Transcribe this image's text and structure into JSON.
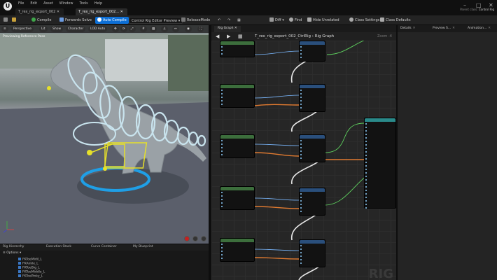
{
  "menu": [
    "File",
    "Edit",
    "Asset",
    "Window",
    "Tools",
    "Help"
  ],
  "doc_tabs": [
    "T_rex_rig_export_002",
    "T_rex_rig_export_002..."
  ],
  "parent_class": {
    "label": "Parent class:",
    "value": "Control Rig"
  },
  "toolbar": {
    "compile": "Compile",
    "forwards_solve": "Forwards Solve",
    "auto_compile": "Auto Compile",
    "preview_mode": "Control Rig Editor Preview",
    "release_mode": "ReleaseMode",
    "diff": "Diff",
    "find": "Find",
    "hide_unrelated": "Hide Unrelated",
    "class_settings": "Class Settings",
    "class_defaults": "Class Defaults"
  },
  "viewport": {
    "buttons": [
      "Perspective",
      "Lit",
      "Show",
      "Character",
      "LOD Auto"
    ],
    "label": "Previewing Reference Pose"
  },
  "hierarchy": {
    "tabs": [
      "Rig Hierarchy",
      "Execution Stack",
      "Curve Container",
      "My Blueprint"
    ],
    "options": "Options",
    "rows": [
      "FKToeMidil_L",
      "FKAnkle_L",
      "FKToeBig_L",
      "FKToeMiddle_L",
      "FKToePinky_L"
    ]
  },
  "graph": {
    "tab": "Rig Graph",
    "breadcrumb": "T_rex_rig_export_002_CtrlRig  ›  Rig Graph",
    "zoom": "Zoom -4",
    "watermark": "RIG"
  },
  "right_tabs": [
    "Details",
    "Preview S...",
    "Animation..."
  ],
  "colors": {
    "accent": "#0d6fd6",
    "viewport_gizmo": "#c9e4ee",
    "selection": "#e6e02a",
    "ring": "#1f9fe6"
  }
}
